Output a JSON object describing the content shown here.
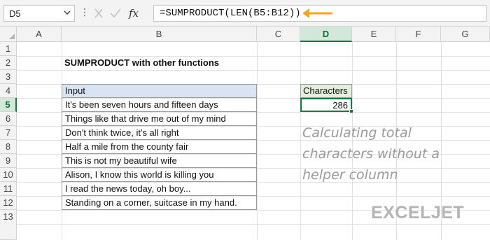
{
  "formula_bar": {
    "name_box": "D5",
    "fx_label": "fx",
    "formula": "=SUMPRODUCT(LEN(B5:B12))"
  },
  "columns": [
    "A",
    "B",
    "C",
    "D",
    "E",
    "F",
    "G"
  ],
  "rows": [
    "1",
    "2",
    "3",
    "4",
    "5",
    "6",
    "7",
    "8",
    "9",
    "10",
    "11",
    "12",
    "13"
  ],
  "selected_cell": {
    "column": "D",
    "row": "5"
  },
  "sheet": {
    "title": "SUMPRODUCT with other functions",
    "input_header": "Input",
    "inputs": [
      "It's been seven hours and fifteen days",
      "Things like that drive me out of my mind",
      "Don't think twice, it's all right",
      "Half a mile from the county fair",
      "This is not my beautiful wife",
      "Alison, I know this world is killing you",
      "I read the news today, oh boy...",
      "Standing on a corner, suitcase in my hand."
    ],
    "result_header": "Characters",
    "result_value": "286",
    "note": "Calculating total\ncharacters without a\nhelper column"
  },
  "branding": {
    "logo_text": "EXCELJET"
  },
  "colors": {
    "accent_green": "#217346",
    "input_header_bg": "#dae3f3",
    "result_header_bg": "#e2efda",
    "arrow_orange": "#f4a62a"
  },
  "icons": {
    "cancel": "x-icon",
    "confirm": "check-icon",
    "function": "fx-icon",
    "arrow": "arrow-left-icon"
  }
}
